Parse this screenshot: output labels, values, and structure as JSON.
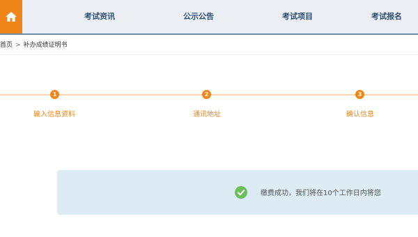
{
  "nav": {
    "home_icon": "home-icon",
    "items": [
      "考试资讯",
      "公示公告",
      "考试项目",
      "考试报名"
    ]
  },
  "breadcrumb": {
    "home": "首页",
    "separator": ">",
    "current": "补办成绩证明书"
  },
  "steps": [
    {
      "number": "1",
      "label": "输入信息资料"
    },
    {
      "number": "2",
      "label": "通讯地址"
    },
    {
      "number": "3",
      "label": "确认信息"
    }
  ],
  "notice": {
    "icon": "check-circle-icon",
    "text": "缴费成功，我们将在10个工作日内将您"
  },
  "colors": {
    "accent": "#f08519",
    "nav_text": "#2e4f73",
    "notice_bg": "#dcebf4",
    "success": "#6cbf5a"
  }
}
